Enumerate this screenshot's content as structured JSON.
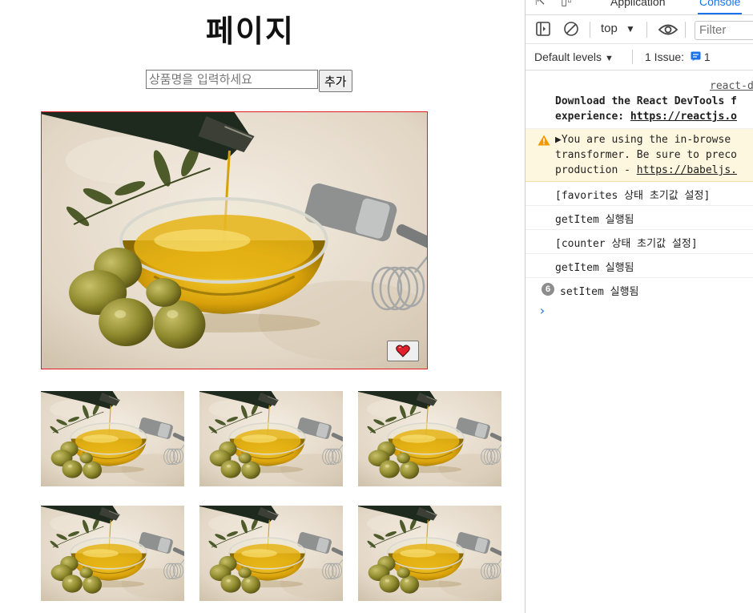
{
  "page": {
    "title": "페이지",
    "input_placeholder": "상품명을 입력하세요",
    "add_button": "추가",
    "favorite_icon": "heart-icon",
    "thumbnail_count": 6
  },
  "devtools": {
    "tabs": [
      "Application",
      "Console"
    ],
    "active_tab": "Console",
    "toolbar": {
      "context": "top",
      "filter_placeholder": "Filter",
      "levels": "Default levels",
      "issues": "1 Issue:",
      "issues_count": "1"
    },
    "console": {
      "source_link": "react-d",
      "devtools_msg_1": "Download the React DevTools f",
      "devtools_msg_2_prefix": "experience: ",
      "devtools_msg_2_link": "https://reactjs.o",
      "warning_1": "▶You are using the in-browse",
      "warning_2": "transformer. Be sure to preco",
      "warning_3_prefix": "production - ",
      "warning_3_link": "https://babeljs.",
      "logs": [
        "[favorites 상태 초기값 설정]",
        "getItem 실행됨",
        "[counter 상태 초기값 설정]",
        "getItem 실행됨"
      ],
      "grouped_count": "6",
      "grouped_msg": "setItem 실행됨",
      "prompt": "›"
    }
  }
}
